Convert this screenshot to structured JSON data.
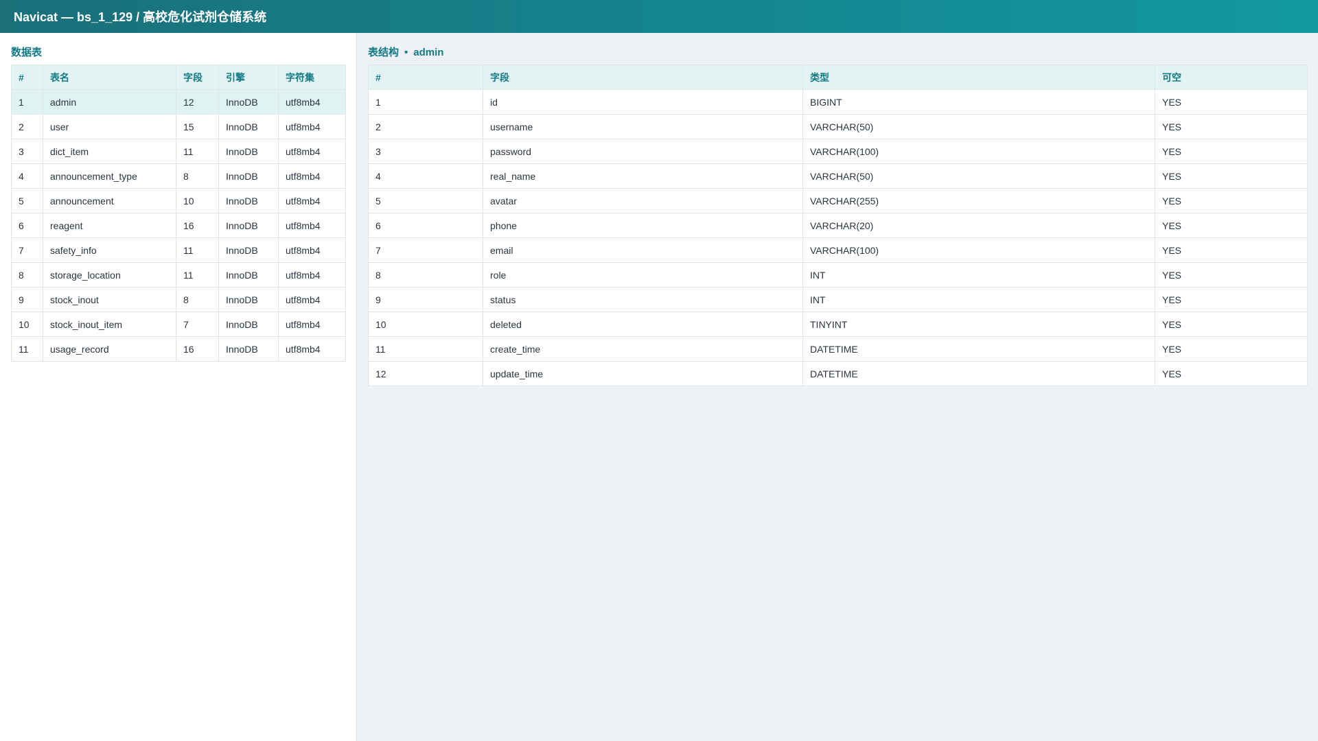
{
  "window": {
    "title": "Navicat — bs_1_129 / 高校危化试剂仓储系统"
  },
  "tables_panel": {
    "title": "数据表",
    "columns": [
      "#",
      "表名",
      "字段",
      "引擎",
      "字符集"
    ],
    "selected_index": 0,
    "rows": [
      [
        "1",
        "admin",
        "12",
        "InnoDB",
        "utf8mb4"
      ],
      [
        "2",
        "user",
        "15",
        "InnoDB",
        "utf8mb4"
      ],
      [
        "3",
        "dict_item",
        "11",
        "InnoDB",
        "utf8mb4"
      ],
      [
        "4",
        "announcement_type",
        "8",
        "InnoDB",
        "utf8mb4"
      ],
      [
        "5",
        "announcement",
        "10",
        "InnoDB",
        "utf8mb4"
      ],
      [
        "6",
        "reagent",
        "16",
        "InnoDB",
        "utf8mb4"
      ],
      [
        "7",
        "safety_info",
        "11",
        "InnoDB",
        "utf8mb4"
      ],
      [
        "8",
        "storage_location",
        "11",
        "InnoDB",
        "utf8mb4"
      ],
      [
        "9",
        "stock_inout",
        "8",
        "InnoDB",
        "utf8mb4"
      ],
      [
        "10",
        "stock_inout_item",
        "7",
        "InnoDB",
        "utf8mb4"
      ],
      [
        "11",
        "usage_record",
        "16",
        "InnoDB",
        "utf8mb4"
      ]
    ]
  },
  "structure_panel": {
    "title": "表结构",
    "separator": "•",
    "table_name": "admin",
    "columns": [
      "#",
      "字段",
      "类型",
      "可空"
    ],
    "rows": [
      [
        "1",
        "id",
        "BIGINT",
        "YES"
      ],
      [
        "2",
        "username",
        "VARCHAR(50)",
        "YES"
      ],
      [
        "3",
        "password",
        "VARCHAR(100)",
        "YES"
      ],
      [
        "4",
        "real_name",
        "VARCHAR(50)",
        "YES"
      ],
      [
        "5",
        "avatar",
        "VARCHAR(255)",
        "YES"
      ],
      [
        "6",
        "phone",
        "VARCHAR(20)",
        "YES"
      ],
      [
        "7",
        "email",
        "VARCHAR(100)",
        "YES"
      ],
      [
        "8",
        "role",
        "INT",
        "YES"
      ],
      [
        "9",
        "status",
        "INT",
        "YES"
      ],
      [
        "10",
        "deleted",
        "TINYINT",
        "YES"
      ],
      [
        "11",
        "create_time",
        "DATETIME",
        "YES"
      ],
      [
        "12",
        "update_time",
        "DATETIME",
        "YES"
      ]
    ]
  },
  "colors": {
    "accent": "#137a85",
    "header_bg": "#e3f3f3",
    "selected_row_bg": "#dff3f3"
  }
}
